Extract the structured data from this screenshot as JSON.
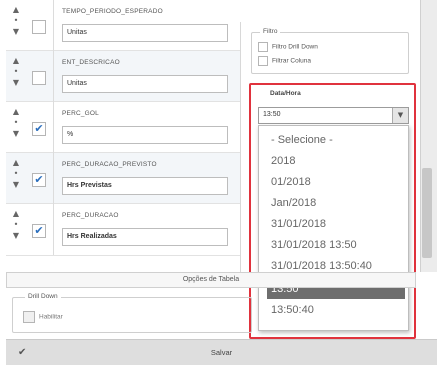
{
  "rows": [
    {
      "field": "TEMPO_PERIODO_ESPERADO",
      "value": "Unitas",
      "checked": false,
      "bold": false
    },
    {
      "field": "ENT_DESCRICAO",
      "value": "Unitas",
      "checked": false,
      "bold": false
    },
    {
      "field": "PERC_GOL",
      "value": "%",
      "checked": true,
      "bold": false
    },
    {
      "field": "PERC_DURACAO_PREVISTO",
      "value": "Hrs Previstas",
      "checked": true,
      "bold": true
    },
    {
      "field": "PERC_DURACAO",
      "value": "Hrs Realizadas",
      "checked": true,
      "bold": true
    }
  ],
  "filter": {
    "legend": "Filtro",
    "options": [
      "Filtro Drill Down",
      "Filtrar Coluna"
    ]
  },
  "date_format": {
    "legend": "Data/Hora",
    "selected": "13:50",
    "options": [
      "- Selecione -",
      "2018",
      "01/2018",
      "Jan/2018",
      "31/01/2018",
      "31/01/2018 13:50",
      "31/01/2018 13:50:40",
      "13:50",
      "13:50:40"
    ],
    "highlighted": "13:50"
  },
  "table_options_label": "Opções de Tabela",
  "drill_down": {
    "legend": "Drill Down",
    "option": "Habilitar"
  },
  "save_label": "Salvar",
  "icons": {
    "checkmark": "✔",
    "arrow_up": "▲",
    "arrow_down": "▼",
    "dropdown_arrow": "▼"
  },
  "colors": {
    "highlight_border": "#e0323d",
    "selected_option_bg": "#6e6e6e"
  }
}
